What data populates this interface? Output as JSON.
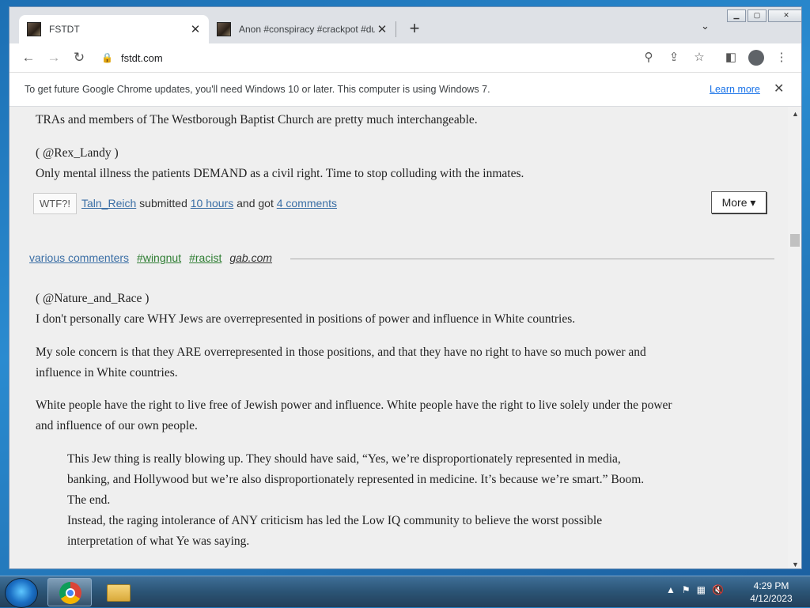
{
  "browser": {
    "tabs": [
      {
        "title": "FSTDT",
        "active": true
      },
      {
        "title": "Anon #conspiracy #crackpot #dumb",
        "active": false
      }
    ],
    "url": "fstdt.com",
    "infobar": {
      "text": "To get future Google Chrome updates, you'll need Windows 10 or later. This computer is using Windows 7.",
      "link": "Learn more"
    }
  },
  "post1": {
    "line1": "TRAs and members of The Westborough Baptist Church are pretty much interchangeable.",
    "author": "( @Rex_Landy )",
    "line2": "Only mental illness the patients DEMAND as a civil right. Time to stop colluding with the inmates.",
    "wtf_label": "WTF?!",
    "submitter": "Taln_Reich",
    "submitted_text": "submitted",
    "time": "10 hours",
    "got_text": "and got",
    "comments": "4 comments",
    "more_label": "More ▾"
  },
  "post2": {
    "source_name": "various commenters",
    "tags": [
      "#wingnut",
      "#racist"
    ],
    "site": "gab.com",
    "author": "( @Nature_and_Race )",
    "paragraphs": [
      "I don't personally care WHY Jews are overrepresented in positions of power and influence in White countries.",
      "My sole concern is that they ARE overrepresented in those positions, and that they have no right to have so much power and",
      "influence in White countries.",
      "White people have the right to live free of Jewish power and influence. White people have the right to live solely under the power",
      "and influence of our own people."
    ],
    "quote": [
      "This Jew thing is really blowing up. They should have said, “Yes, we’re disproportionately represented in media,",
      "banking, and Hollywood but we’re also disproportionately represented in medicine. It’s because we’re smart.” Boom.",
      "The end.",
      "Instead, the raging intolerance of ANY criticism has led the Low IQ community to believe the worst possible",
      "interpretation of what Ye was saying."
    ]
  },
  "taskbar": {
    "time": "4:29 PM",
    "date": "4/12/2023"
  }
}
